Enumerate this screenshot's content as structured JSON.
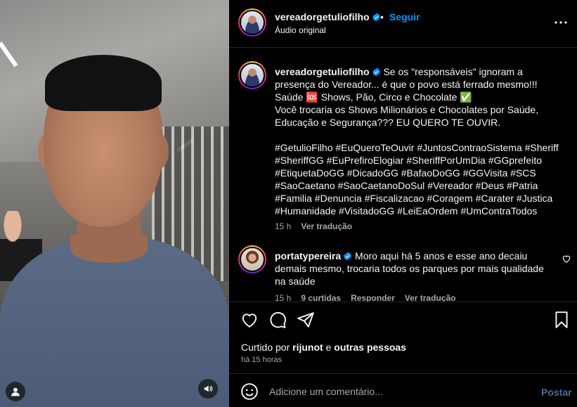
{
  "header": {
    "username": "vereadorgetuliofilho",
    "dot": "•",
    "follow_label": "Seguir",
    "audio_label": "Áudio original"
  },
  "caption": {
    "username": "vereadorgetuliofilho",
    "lines": [
      "Se os \"responsáveis\" ignoram a presença do Vereador... é que o povo está ferrado mesmo!!!",
      "Saúde 🆘 Shows, Pão, Circo e Chocolate ✅",
      "Você trocaria os Shows Milionários e Chocolates por Saúde, Educação e Segurança??? EU QUERO TE OUVIR."
    ],
    "hashtags": "#GetulioFilho #EuQueroTeOuvir #JuntosContraoSistema #Sheriff #SheriffGG #EuPrefiroElogiar #SheriffPorUmDia #GGprefeito #EtiquetaDoGG #DicadoGG #BafaoDoGG #GGVisita #SCS #SaoCaetano #SaoCaetanoDoSul #Vereador #Deus #Patria #Familia #Denuncia #Fiscalizacao #Coragem #Carater #Justica #Humanidade #VisitadoGG #LeiEaOrdem #UmContraTodos",
    "time": "15 h",
    "translate_label": "Ver tradução"
  },
  "comment": {
    "username": "portatypereira",
    "text": "Moro aqui há 5 anos e esse ano decaiu demais mesmo, trocaria todos os parques por mais qualidade na saúde",
    "time": "15 h",
    "likes_label": "9 curtidas",
    "reply_label": "Responder",
    "translate_label": "Ver tradução"
  },
  "actions": {
    "liked_prefix": "Curtido por",
    "liked_user": "rijunot",
    "liked_and": "e",
    "liked_others": "outras pessoas",
    "time_ago": "há 15 horas"
  },
  "add_comment": {
    "placeholder": "Adicione um comentário...",
    "post_label": "Postar"
  },
  "colors": {
    "accent": "#0095f6",
    "muted": "#a8a8a8",
    "post_disabled": "#4a6f97",
    "background": "#000000"
  },
  "icons": [
    "user-icon",
    "speaker-icon",
    "verified-icon",
    "more-icon",
    "heart-icon",
    "comment-icon",
    "share-icon",
    "bookmark-icon",
    "emoji-icon"
  ]
}
